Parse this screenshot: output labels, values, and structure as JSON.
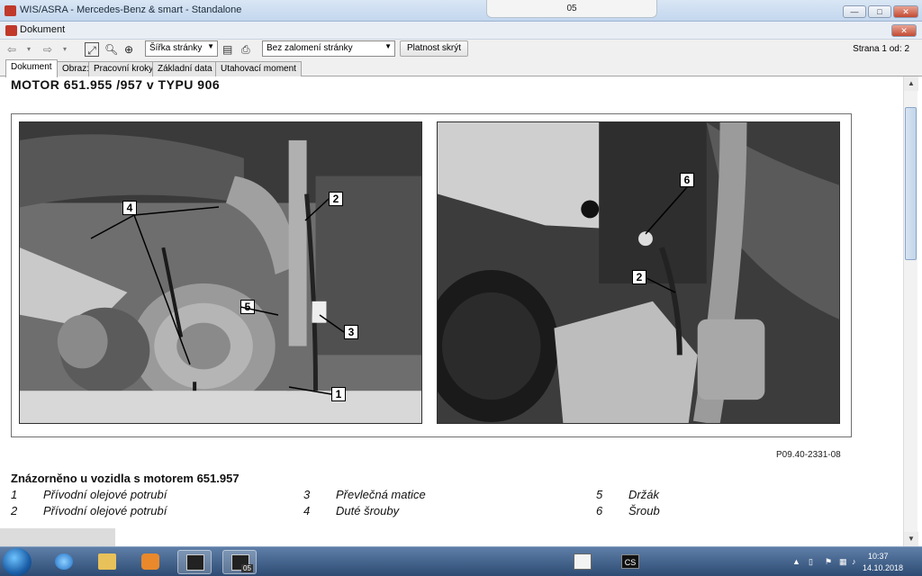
{
  "window": {
    "title": "WIS/ASRA - Mercedes-Benz & smart - Standalone",
    "center_tab": "05",
    "minimize": "—",
    "maximize": "□",
    "close": "✕"
  },
  "document_window": {
    "title": "Dokument",
    "close": "✕"
  },
  "toolbar": {
    "zoom_select": "Šířka stránky",
    "break_select": "Bez zalomení stránky",
    "validity_button": "Platnost skrýt",
    "page_label": "Strana",
    "page_current": "1",
    "page_of_label": "od:",
    "page_total": "2"
  },
  "tabs": [
    {
      "label": "Dokument",
      "active": true
    },
    {
      "label": "Obraz:",
      "active": false
    },
    {
      "label": "Pracovní kroky",
      "active": false
    },
    {
      "label": "Základní data",
      "active": false
    },
    {
      "label": "Utahovací moment",
      "active": false
    }
  ],
  "document": {
    "heading": "MOTOR 651.955 /957 v TYPU 906",
    "figure_ref": "P09.40-2331-08",
    "caption_title": "Znázorněno u vozidla s motorem 651.957",
    "legend": [
      {
        "num": "1",
        "text": "Přívodní olejové potrubí"
      },
      {
        "num": "2",
        "text": "Přívodní olejové potrubí"
      },
      {
        "num": "3",
        "text": "Převlečná matice"
      },
      {
        "num": "4",
        "text": "Duté šrouby"
      },
      {
        "num": "5",
        "text": "Držák"
      },
      {
        "num": "6",
        "text": "Šroub"
      }
    ],
    "photo_left_callouts": [
      "4",
      "2",
      "5",
      "3",
      "1"
    ],
    "photo_right_callouts": [
      "6",
      "2"
    ]
  },
  "taskbar": {
    "active_item_badge": "05",
    "tray_app": "CS",
    "time": "10:37",
    "date": "14.10.2018"
  },
  "colors": {
    "accent": "#2d4b73",
    "close": "#c34a32",
    "tab_active": "#ffffff"
  }
}
